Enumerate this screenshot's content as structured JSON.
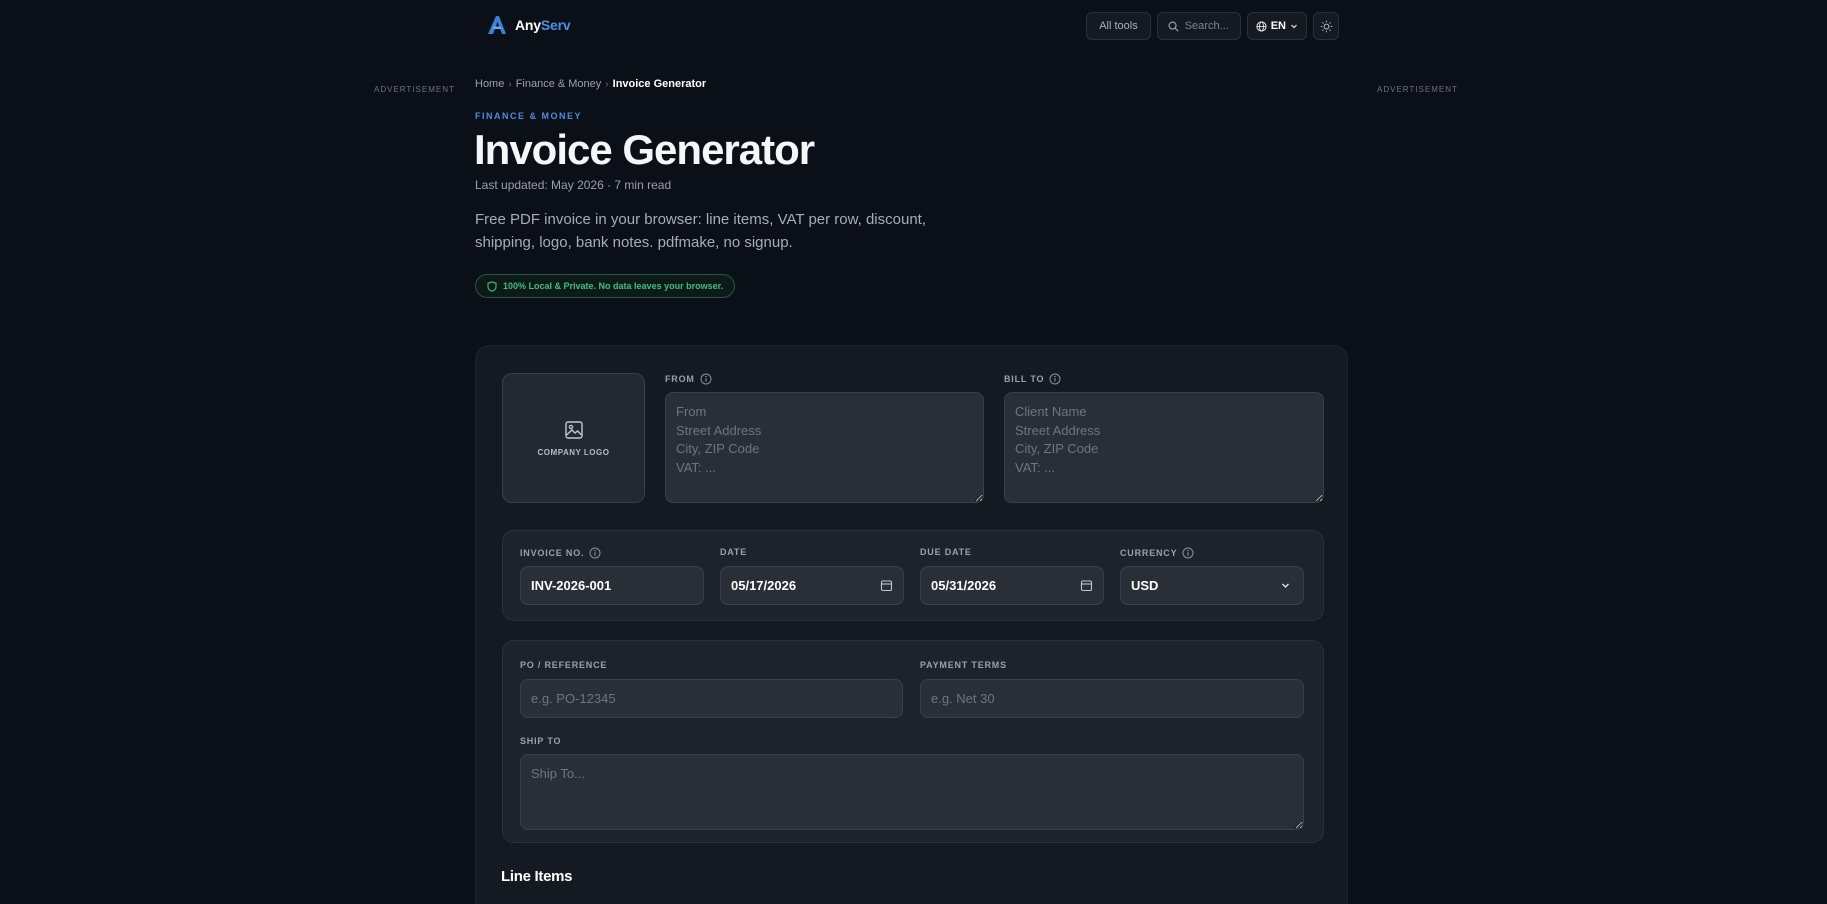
{
  "header": {
    "brand_part1": "Any",
    "brand_part2": "Serv",
    "all_tools": "All tools",
    "search_placeholder": "Search...",
    "language": "EN"
  },
  "ads": {
    "left": "ADVERTISEMENT",
    "right": "ADVERTISEMENT"
  },
  "breadcrumb": {
    "home": "Home",
    "category": "Finance & Money",
    "current": "Invoice Generator"
  },
  "page": {
    "category": "FINANCE & MONEY",
    "title": "Invoice Generator",
    "meta": "Last updated: May 2026 · 7 min read",
    "description": "Free PDF invoice in your browser: line items, VAT per row, discount, shipping, logo, bank notes. pdfmake, no signup.",
    "privacy": "100% Local & Private. No data leaves your browser."
  },
  "form": {
    "company_logo": "COMPANY LOGO",
    "from_label": "FROM",
    "from_placeholder": "From\nStreet Address\nCity, ZIP Code\nVAT: ...",
    "bill_to_label": "BILL TO",
    "bill_to_placeholder": "Client Name\nStreet Address\nCity, ZIP Code\nVAT: ...",
    "invoice_no_label": "INVOICE NO.",
    "invoice_no_value": "INV-2026-001",
    "date_label": "DATE",
    "date_value": "05/17/2026",
    "due_date_label": "DUE DATE",
    "due_date_value": "05/31/2026",
    "currency_label": "CURRENCY",
    "currency_value": "USD",
    "po_label": "PO / REFERENCE",
    "po_placeholder": "e.g. PO-12345",
    "terms_label": "PAYMENT TERMS",
    "terms_placeholder": "e.g. Net 30",
    "ship_to_label": "SHIP TO",
    "ship_to_placeholder": "Ship To...",
    "line_items_title": "Line Items"
  },
  "colors": {
    "accent": "#4a90e2",
    "success": "#3bbf8a",
    "background": "#0b0f17",
    "card": "#151a22"
  }
}
